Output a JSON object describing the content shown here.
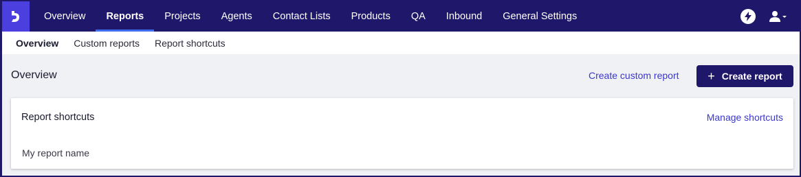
{
  "topnav": {
    "items": [
      {
        "label": "Overview"
      },
      {
        "label": "Reports",
        "active": true
      },
      {
        "label": "Projects"
      },
      {
        "label": "Agents"
      },
      {
        "label": "Contact Lists"
      },
      {
        "label": "Products"
      },
      {
        "label": "QA"
      },
      {
        "label": "Inbound"
      },
      {
        "label": "General Settings"
      }
    ],
    "icons": {
      "logo": "app-logo-icon",
      "bolt": "lightning-bolt-icon",
      "user": "user-menu-icon"
    }
  },
  "subnav": {
    "items": [
      {
        "label": "Overview",
        "active": true
      },
      {
        "label": "Custom reports"
      },
      {
        "label": "Report shortcuts"
      }
    ]
  },
  "page": {
    "title": "Overview",
    "create_custom_label": "Create custom report",
    "create_report_label": "Create report"
  },
  "shortcuts_card": {
    "title": "Report shortcuts",
    "manage_label": "Manage shortcuts",
    "items": [
      {
        "label": "My report name"
      }
    ]
  },
  "colors": {
    "nav_bg": "#1f1769",
    "logo_bg": "#4b3fe0",
    "active_underline": "#3d6ef0",
    "link": "#3b37c9",
    "page_bg": "#f0f1f5"
  }
}
